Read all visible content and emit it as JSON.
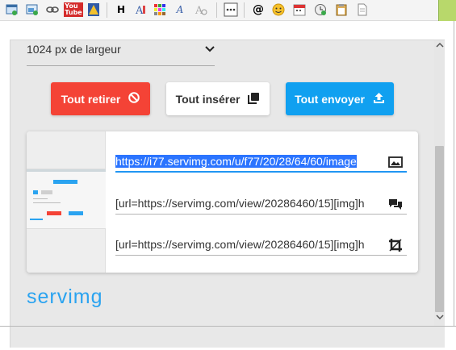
{
  "toolbar": {
    "youtube_label": "You Tube",
    "bold_label": "H",
    "text_a_label": "A",
    "at_label": "@"
  },
  "select": {
    "value": "1024 px de largeur",
    "chevron": "⌄"
  },
  "buttons": {
    "remove_all": "Tout retirer",
    "insert_all": "Tout insérer",
    "send_all": "Tout envoyer"
  },
  "links": {
    "direct": "https://i77.servimg.com/u/f77/20/28/64/60/image",
    "bbcode_view": "[url=https://servimg.com/view/20286460/15][img]h",
    "bbcode_crop": "[url=https://servimg.com/view/20286460/15][img]h"
  },
  "brand": "servimg",
  "colors": {
    "red": "#f44336",
    "blue": "#10a0f0",
    "brand": "#2aa3f0",
    "selection": "#2b74ff"
  }
}
